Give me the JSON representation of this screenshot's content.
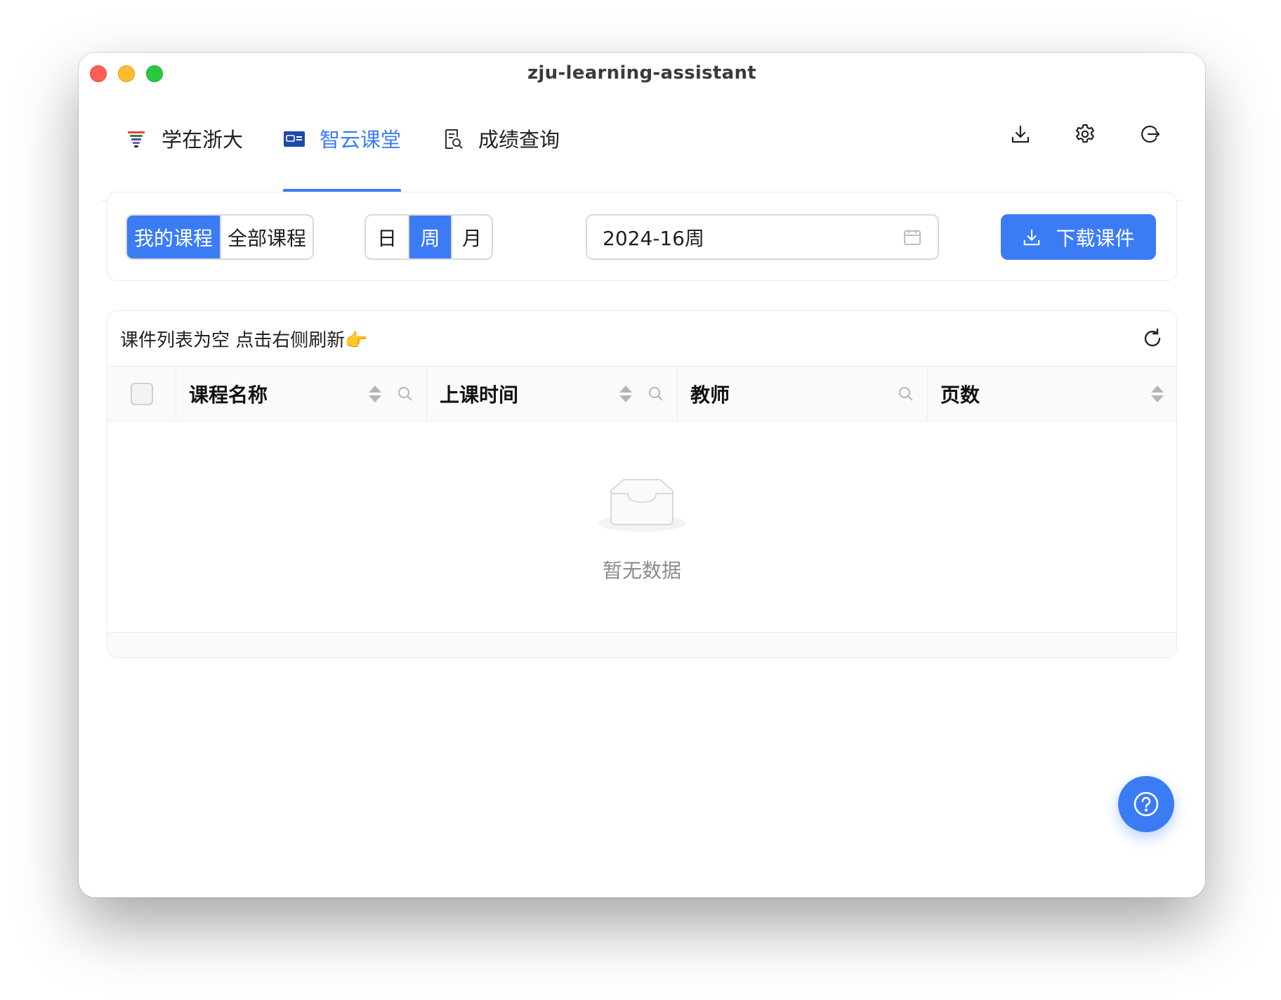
{
  "window": {
    "title": "zju-learning-assistant"
  },
  "nav": {
    "tabs": [
      {
        "label": "学在浙大",
        "icon": "zju-logo-icon"
      },
      {
        "label": "智云课堂",
        "icon": "zhiyun-classroom-icon"
      },
      {
        "label": "成绩查询",
        "icon": "grade-search-icon"
      }
    ],
    "active_tab": "智云课堂",
    "actions": [
      "download-icon",
      "gear-icon",
      "logout-icon"
    ]
  },
  "toolbar": {
    "course_scope": [
      "我的课程",
      "全部课程"
    ],
    "course_scope_selected": "我的课程",
    "period": [
      "日",
      "周",
      "月"
    ],
    "period_selected": "周",
    "date_value": "2024-16周",
    "download_label": "下载课件"
  },
  "table": {
    "caption": "课件列表为空 点击右侧刷新👉",
    "columns": [
      {
        "label": "课程名称",
        "sortable": true,
        "filterable": true
      },
      {
        "label": "上课时间",
        "sortable": true,
        "filterable": true
      },
      {
        "label": "教师",
        "sortable": false,
        "filterable": true
      },
      {
        "label": "页数",
        "sortable": true,
        "filterable": false
      }
    ],
    "empty_text": "暂无数据"
  },
  "colors": {
    "accent": "#3b7cf5",
    "border": "#d9d9d9",
    "muted": "#8c8c8c"
  }
}
